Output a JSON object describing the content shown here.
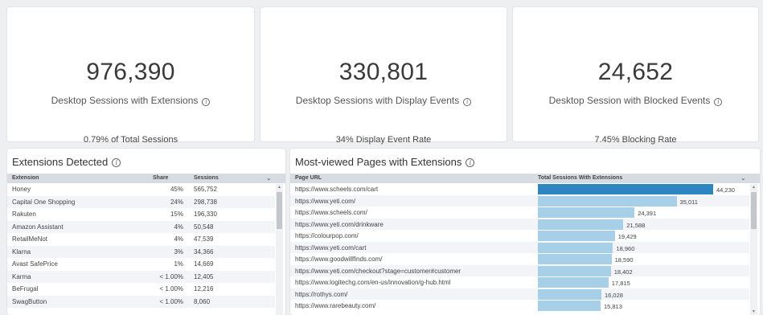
{
  "kpis": [
    {
      "value": "976,390",
      "label": "Desktop Sessions with Extensions",
      "sub": "0.79% of Total Sessions"
    },
    {
      "value": "330,801",
      "label": "Desktop Sessions with Display Events",
      "sub": "34% Display Event Rate"
    },
    {
      "value": "24,652",
      "label": "Desktop Session with Blocked Events",
      "sub": "7.45% Blocking Rate"
    }
  ],
  "info_glyph": "i",
  "chevron_glyph": "⌄",
  "extensions": {
    "title": "Extensions Detected",
    "columns": [
      "Extension",
      "Share",
      "Sessions"
    ],
    "rows": [
      [
        "Honey",
        "45%",
        "565,752"
      ],
      [
        "Capital One Shopping",
        "24%",
        "298,738"
      ],
      [
        "Rakuten",
        "15%",
        "196,330"
      ],
      [
        "Amazon Assistant",
        "4%",
        "50,548"
      ],
      [
        "RetailMeNot",
        "4%",
        "47,539"
      ],
      [
        "Klarna",
        "3%",
        "34,366"
      ],
      [
        "Avast SafePrice",
        "1%",
        "14,669"
      ],
      [
        "Karma",
        "< 1.00%",
        "12,405"
      ],
      [
        "BeFrugal",
        "< 1.00%",
        "12,216"
      ],
      [
        "SwagButton",
        "< 1.00%",
        "8,060"
      ]
    ]
  },
  "pages": {
    "title": "Most-viewed Pages with Extensions",
    "columns": [
      "Page URL",
      "Total Sessions With Extensions"
    ],
    "bar_color": "#2e86c1",
    "bar_color_light": "#a8cfe8",
    "rows": [
      {
        "url": "https://www.scheels.com/cart",
        "sessions": 44230,
        "label": "44,230"
      },
      {
        "url": "https://www.yeti.com/",
        "sessions": 35011,
        "label": "35,011"
      },
      {
        "url": "https://www.scheels.com/",
        "sessions": 24391,
        "label": "24,391"
      },
      {
        "url": "https://www.yeti.com/drinkware",
        "sessions": 21588,
        "label": "21,588"
      },
      {
        "url": "https://colourpop.com/",
        "sessions": 19429,
        "label": "19,429"
      },
      {
        "url": "https://www.yeti.com/cart",
        "sessions": 18960,
        "label": "18,960"
      },
      {
        "url": "https://www.goodwillfinds.com/",
        "sessions": 18590,
        "label": "18,590"
      },
      {
        "url": "https://www.yeti.com/checkout?stage=customer#customer",
        "sessions": 18402,
        "label": "18,402"
      },
      {
        "url": "https://www.logitechg.com/en-us/innovation/g-hub.html",
        "sessions": 17815,
        "label": "17,815"
      },
      {
        "url": "https://rothys.com/",
        "sessions": 16028,
        "label": "16,028"
      },
      {
        "url": "https://www.rarebeauty.com/",
        "sessions": 15813,
        "label": "15,813"
      }
    ]
  }
}
